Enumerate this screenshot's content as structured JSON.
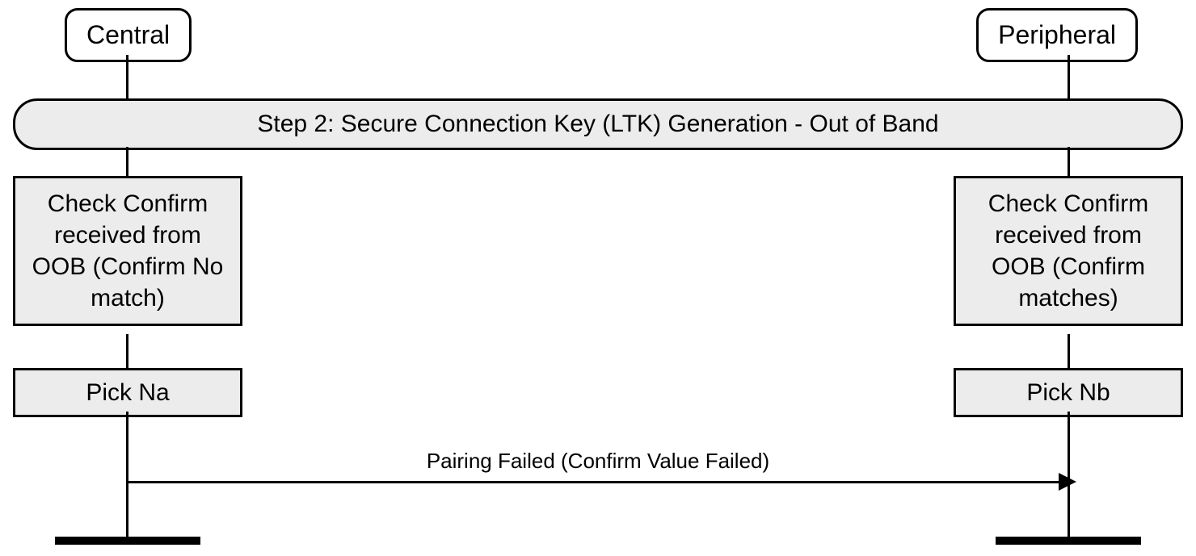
{
  "actors": {
    "central": "Central",
    "peripheral": "Peripheral"
  },
  "banner": "Step 2: Secure Connection Key (LTK) Generation - Out of Band",
  "processes": {
    "check_central": "Check Confirm received from OOB (Confirm No match)",
    "check_peripheral": "Check Confirm received from OOB (Confirm matches)",
    "pick_central": "Pick Na",
    "pick_peripheral": "Pick Nb"
  },
  "message": "Pairing Failed (Confirm Value Failed)"
}
